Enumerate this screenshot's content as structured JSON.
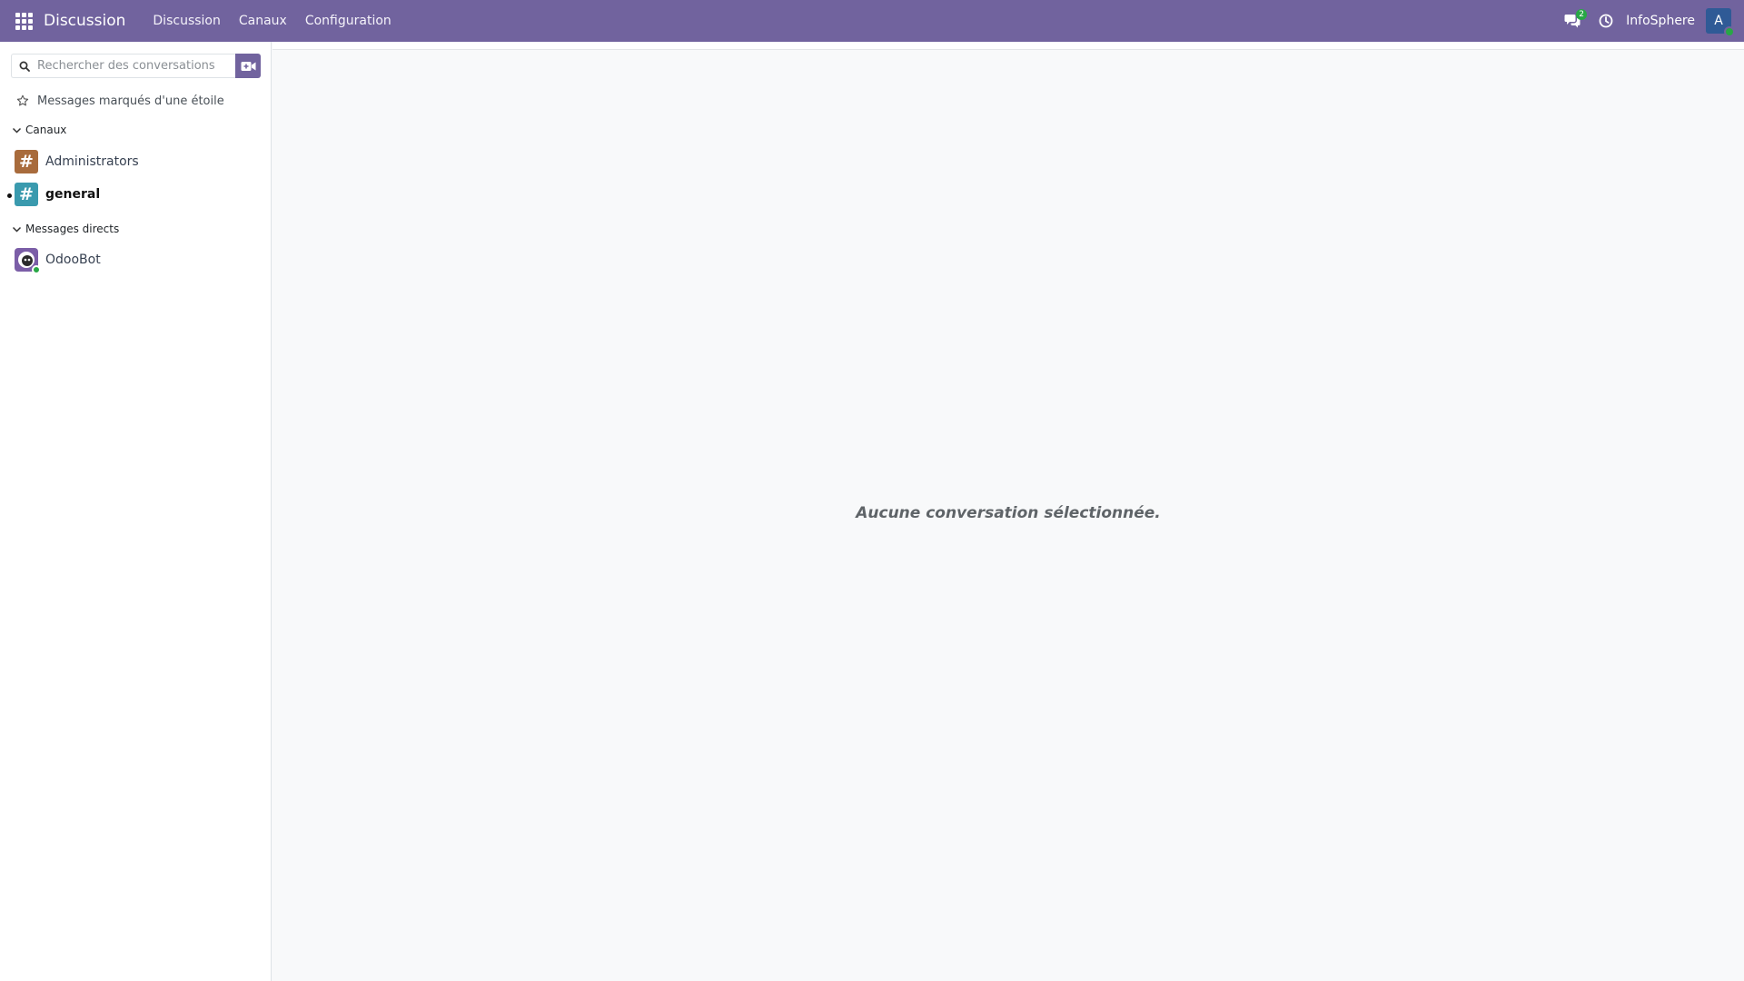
{
  "navbar": {
    "brand": "Discussion",
    "menu": [
      "Discussion",
      "Canaux",
      "Configuration"
    ],
    "messages_badge": "2",
    "company": "InfoSphere",
    "avatar_letter": "A",
    "accent_color": "#71639e"
  },
  "sidebar": {
    "search_placeholder": "Rechercher des conversations",
    "starred_label": "Messages marqués d'une étoile",
    "channels_category": "Canaux",
    "channels": [
      {
        "name": "Administrators",
        "color": "#a86b3c",
        "unread": false
      },
      {
        "name": "general",
        "color": "#3a9aae",
        "unread": true
      }
    ],
    "direct_category": "Messages directs",
    "direct": [
      {
        "name": "OdooBot",
        "status": "online"
      }
    ]
  },
  "main": {
    "empty_message": "Aucune conversation sélectionnée."
  },
  "icons": {
    "apps": "apps-grid-icon",
    "messages": "chat-bubbles-icon",
    "activities": "clock-icon",
    "search": "search-icon",
    "call": "video-call-icon",
    "star": "star-icon",
    "chevron": "chevron-down-icon",
    "hash": "hash-icon"
  }
}
